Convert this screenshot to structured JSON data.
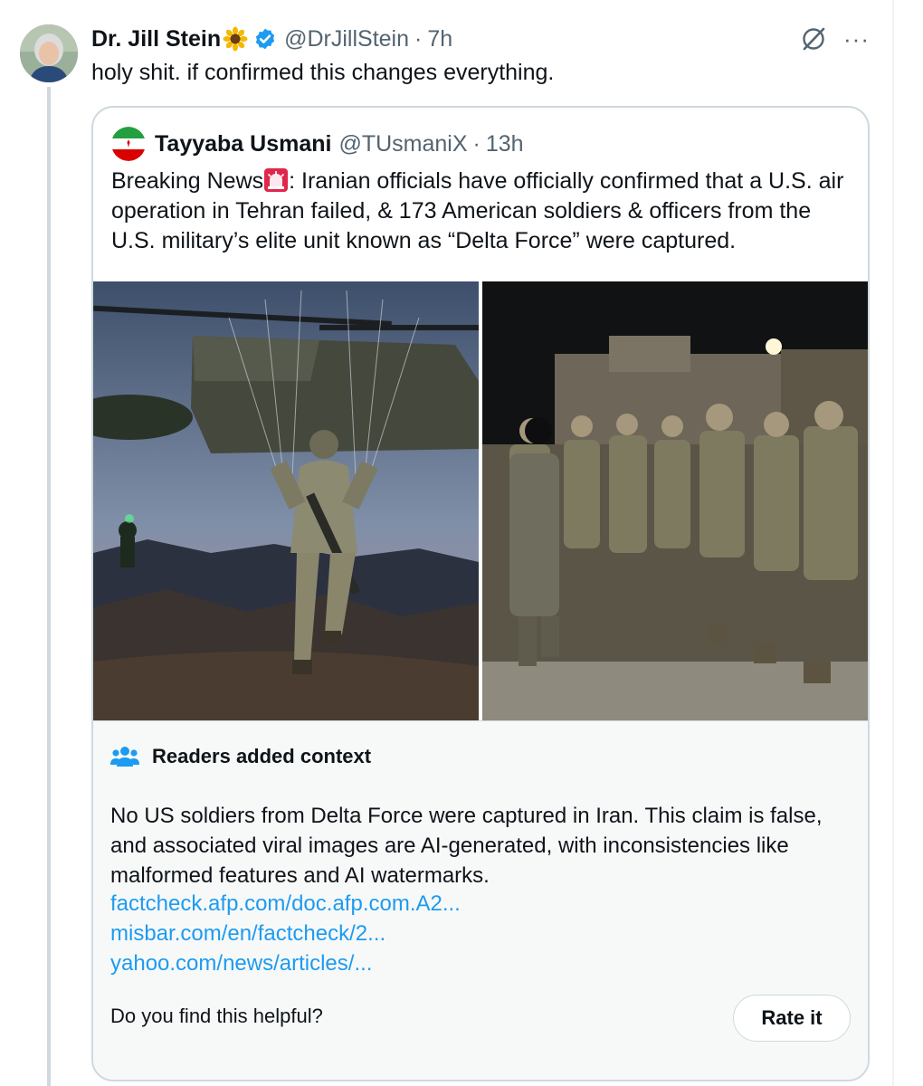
{
  "tweet": {
    "author_name": "Dr. Jill Stein",
    "handle": "@DrJillStein",
    "time": "7h",
    "text": "holy shit. if confirmed this changes everything.",
    "icons": {
      "emoji": "sunflower-icon",
      "badge": "verified-badge-icon",
      "grok": "grok-icon",
      "more": "more-options-icon"
    },
    "more_glyph": "···"
  },
  "quote": {
    "author_name": "Tayyaba Usmani",
    "handle": "@TUsmaniX",
    "time": "13h",
    "text_before_emoji": "Breaking News",
    "text_after_emoji": ": Iranian officials have officially confirmed that a U.S. air operation in Tehran failed, & 173 American soldiers & officers from the U.S. military’s elite unit known as “Delta Force” were captured.",
    "icons": {
      "avatar": "iran-flag-avatar",
      "emoji": "police-siren-icon"
    },
    "images": [
      "parachute-soldier-photo",
      "soldiers-marching-photo"
    ]
  },
  "community_note": {
    "title": "Readers added context",
    "body": "No US soldiers from Delta Force were captured in Iran. This claim is false, and associated viral images are AI-generated, with inconsistencies like malformed features and AI watermarks.",
    "links": [
      "factcheck.afp.com/doc.afp.com.A2...",
      "misbar.com/en/factcheck/2...",
      "yahoo.com/news/articles/..."
    ],
    "question": "Do you find this helpful?",
    "button_label": "Rate it"
  },
  "colors": {
    "text": "#0f1419",
    "secondary": "#536471",
    "link": "#1d9bf0",
    "border": "#cfd9de",
    "note_bg": "#f7f9f9",
    "verified": "#1d9bf0"
  }
}
